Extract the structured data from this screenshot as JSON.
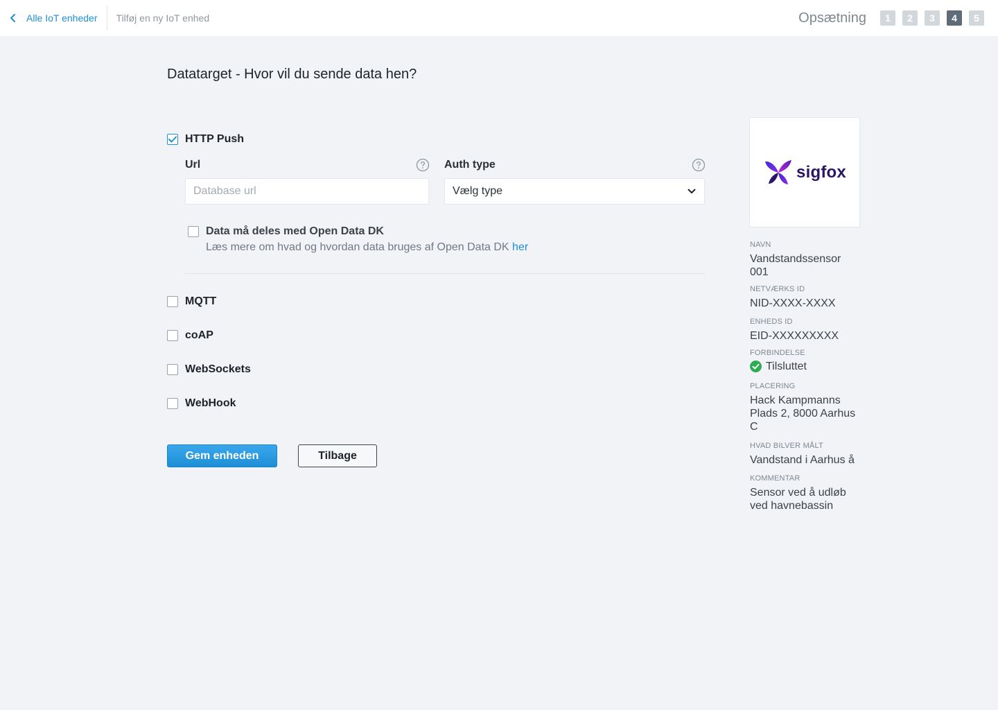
{
  "topbar": {
    "back_label": "Alle IoT enheder",
    "current_page": "Tilføj en ny IoT enhed",
    "steps_label": "Opsætning",
    "steps": [
      "1",
      "2",
      "3",
      "4",
      "5"
    ],
    "active_step": "4"
  },
  "main": {
    "title": "Datatarget - Hvor vil du sende data hen?",
    "http_push": {
      "label": "HTTP Push",
      "checked": true,
      "url_label": "Url",
      "url_placeholder": "Database url",
      "url_value": "",
      "auth_label": "Auth type",
      "auth_selected": "Vælg type",
      "opendata_label": "Data må deles med Open Data DK",
      "opendata_checked": false,
      "opendata_note": "Læs mere om hvad og hvordan data bruges af Open Data DK",
      "opendata_link": "her"
    },
    "options": [
      {
        "label": "MQTT",
        "checked": false
      },
      {
        "label": "coAP",
        "checked": false
      },
      {
        "label": "WebSockets",
        "checked": false
      },
      {
        "label": "WebHook",
        "checked": false
      }
    ],
    "save_label": "Gem enheden",
    "back_button_label": "Tilbage"
  },
  "device": {
    "logo_text": "sigfox",
    "fields": {
      "name_label": "NAVN",
      "name": "Vandstandssensor 001",
      "network_id_label": "NETVÆRKS ID",
      "network_id": "NID-XXXX-XXXX",
      "device_id_label": "ENHEDS ID",
      "device_id": "EID-XXXXXXXXX",
      "connection_label": "FORBINDELSE",
      "connection": "Tilsluttet",
      "location_label": "PLACERING",
      "location": "Hack Kampmanns Plads 2, 8000 Aarhus C",
      "measures_label": "HVAD BILVER MÅLT",
      "measures": "Vandstand i Aarhus å",
      "comment_label": "KOMMENTAR",
      "comment": "Sensor ved å udløb ved havnebassin"
    }
  },
  "colors": {
    "accent": "#1e8fd6",
    "background": "#f1f3f7",
    "connected": "#2eab55",
    "step_active": "#5e6b78",
    "step_inactive": "#d2d7dc"
  }
}
